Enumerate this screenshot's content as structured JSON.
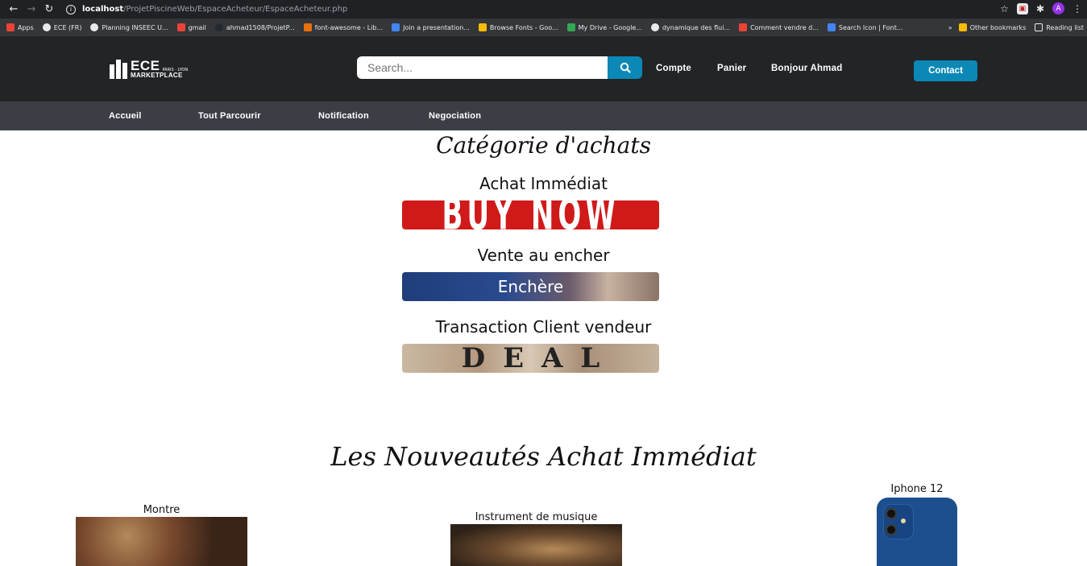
{
  "browser": {
    "url_host": "localhost",
    "url_path": "/ProjetPiscineWeb/EspaceAcheteur/EspaceAcheteur.php",
    "profile_initial": "A",
    "bookmarks": [
      {
        "label": "Apps",
        "color": "#f4b400"
      },
      {
        "label": "ECE (FR)",
        "color": "#e8eaed"
      },
      {
        "label": "Planning INSEEC U...",
        "color": "#e8eaed"
      },
      {
        "label": "gmail",
        "color": "#ea4335"
      },
      {
        "label": "ahmad1508/ProjetP...",
        "color": "#24292e"
      },
      {
        "label": "font-awesome - Lib...",
        "color": "#e8710a"
      },
      {
        "label": "Join a presentation...",
        "color": "#4285f4"
      },
      {
        "label": "Browse Fonts - Goo...",
        "color": "#fbbc04"
      },
      {
        "label": "My Drive - Google...",
        "color": "#34a853"
      },
      {
        "label": "dynamique des flui...",
        "color": "#e8eaed"
      },
      {
        "label": "Comment vendre d...",
        "color": "#ea4335"
      },
      {
        "label": "Search Icon | Font...",
        "color": "#4285f4"
      }
    ],
    "other_bookmarks": "Other bookmarks",
    "reading_list": "Reading list"
  },
  "header": {
    "logo_big": "ECE",
    "logo_small": "MARKETPLACE",
    "logo_sub": "PARIS · LYON",
    "search_placeholder": "Search...",
    "links": {
      "account": "Compte",
      "cart": "Panier",
      "greeting": "Bonjour Ahmad"
    },
    "contact": "Contact"
  },
  "subnav": {
    "home": "Accueil",
    "browse": "Tout Parcourir",
    "notification": "Notification",
    "negotiation": "Negociation"
  },
  "categories": {
    "title": "Catégorie d'achats",
    "immediate": {
      "label": "Achat Immédiat",
      "banner": "BUY NOW"
    },
    "auction": {
      "label": "Vente au encher",
      "banner": "Enchère"
    },
    "transaction": {
      "label": "Transaction Client vendeur",
      "banner": "DEAL"
    }
  },
  "new_items": {
    "title": "Les Nouveautés Achat Immédiat",
    "products": [
      {
        "name": "Montre"
      },
      {
        "name": "Instrument de musique"
      },
      {
        "name": "Iphone 12"
      }
    ]
  }
}
